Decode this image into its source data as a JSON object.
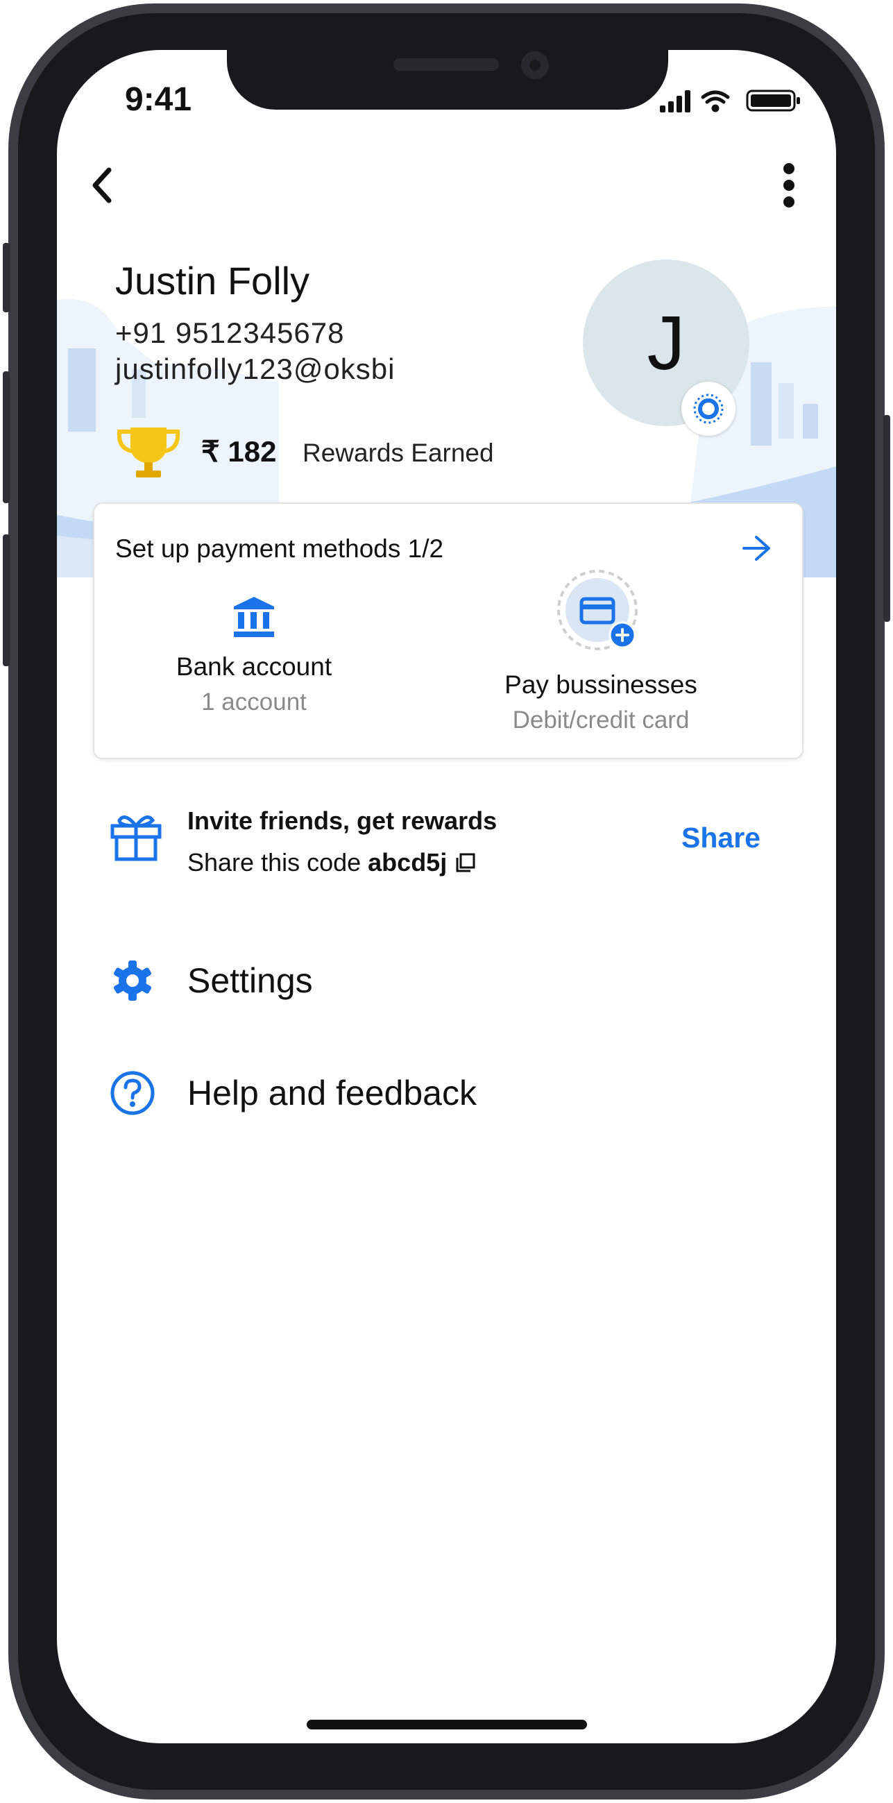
{
  "status_bar": {
    "time": "9:41"
  },
  "profile": {
    "name": "Justin Folly",
    "phone": "+91 9512345678",
    "email": "justinfolly123@oksbi",
    "avatar_initial": "J",
    "rewards_amount": "₹ 182",
    "rewards_label": "Rewards Earned"
  },
  "payment_setup": {
    "title": "Set up payment methods 1/2",
    "methods": [
      {
        "label": "Bank account",
        "sub": "1 account",
        "icon": "bank-icon"
      },
      {
        "label": "Pay bussinesses",
        "sub": "Debit/credit card",
        "icon": "credit-card-add-icon"
      }
    ]
  },
  "invite": {
    "title": "Invite friends, get rewards",
    "code_prefix": "Share this code",
    "code": "abcd5j",
    "share_label": "Share"
  },
  "menu": {
    "settings_label": "Settings",
    "help_label": "Help and feedback"
  },
  "colors": {
    "accent": "#1a73e8",
    "trophy": "#f5c518",
    "avatar_bg": "#dbe6ea",
    "hero_bg": "#dce8f7"
  }
}
